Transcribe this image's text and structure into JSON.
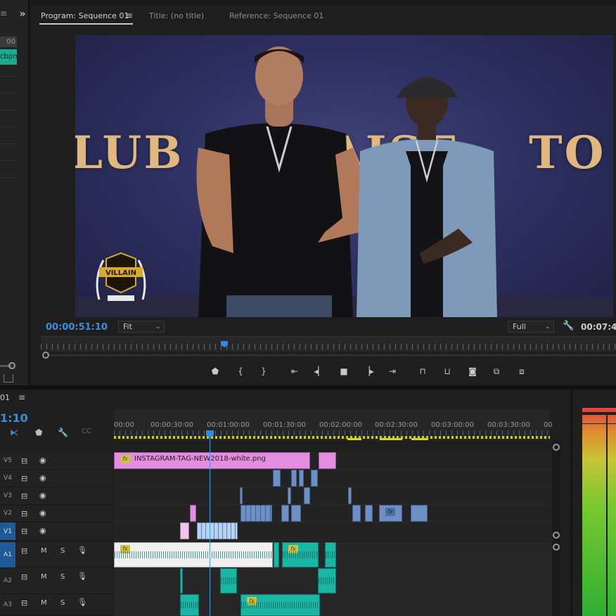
{
  "left_panel": {
    "time_partial": "00",
    "bpm_partial": "cbpm"
  },
  "program_monitor": {
    "tabs": [
      {
        "label": "Program: Sequence 01"
      },
      {
        "label": "Title: (no title)"
      },
      {
        "label": "Reference: Sequence 01"
      }
    ],
    "video": {
      "banner_text_left": "LUB",
      "banner_text_right_a": "AISE",
      "banner_text_right_b": "TO",
      "logo_text": "VILLAIN"
    },
    "current_time": "00:00:51:10",
    "zoom": "Fit",
    "quality": "Full",
    "duration_partial": "00:07:4",
    "playhead_fraction": 0.31
  },
  "timeline": {
    "sequence_name_partial": "01",
    "current_time_partial": "1:10",
    "ruler_labels": [
      "00:00",
      "00:00:30:00",
      "00:01:00:00",
      "00:01:30:00",
      "00:02:00:00",
      "00:02:30:00",
      "00:03:00:00",
      "00:03:30:00",
      "00"
    ],
    "tracks": {
      "v5": "V5",
      "v4": "V4",
      "v3": "V3",
      "v2": "V2",
      "v1": "V1",
      "a1": "A1",
      "a2": "A2",
      "a3": "A3"
    },
    "mute_label": "M",
    "solo_label": "S",
    "clip_v5_name": "INSTAGRAM-TAG-NEW2018-white.png",
    "fx_label": "fx"
  },
  "colors": {
    "accent_blue": "#2d8ceb",
    "timecode_blue": "#3d8ed8",
    "clip_pink": "#e38de0",
    "clip_blue": "#6c8fc6",
    "clip_teal": "#19b6a5",
    "target_track": "#1f5a98"
  }
}
